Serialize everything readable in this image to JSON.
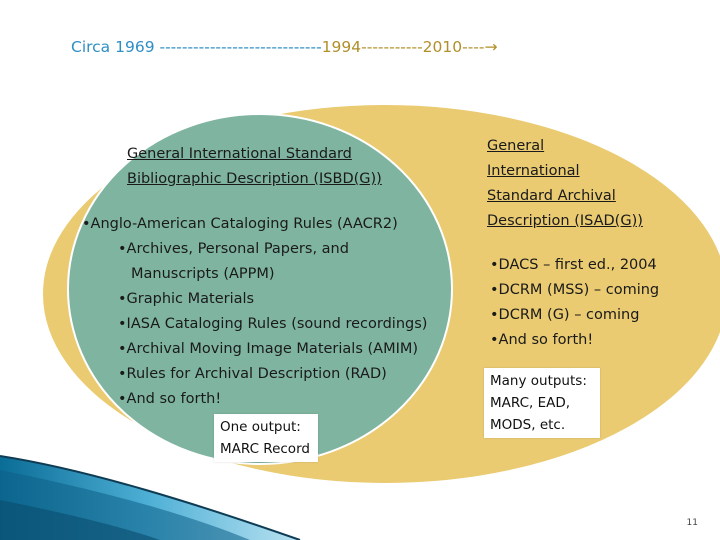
{
  "timeline": {
    "start": "Circa 1969",
    "dash1": " -----------------------------",
    "mid": "1994",
    "dash2": "-----------",
    "end": "2010",
    "dash3": "----",
    "arrow": "→"
  },
  "isbd": {
    "title_line1": "General International Standard",
    "title_line2": "Bibliographic Description (ISBD(G))",
    "items": [
      "•Anglo-American Cataloging Rules (AACR2)",
      "•Archives, Personal Papers, and",
      "Manuscripts (APPM)",
      "•Graphic Materials",
      "•IASA Cataloging Rules (sound recordings)",
      "•Archival Moving Image Materials (AMIM)",
      "•Rules for Archival Description (RAD)",
      "•And so forth!"
    ],
    "output_line1": "One output:",
    "output_line2": "MARC Record"
  },
  "isad": {
    "title_line1": "General",
    "title_line2": "International",
    "title_line3": "Standard Archival",
    "title_line4": "Description (ISAD(G))",
    "items": [
      "•DACS – first ed., 2004",
      "•DCRM (MSS) – coming",
      "•DCRM (G) – coming",
      "•And so forth!"
    ],
    "output_line1": "Many outputs:",
    "output_line2": "MARC, EAD,",
    "output_line3": "MODS, etc."
  },
  "page_number": "11",
  "colors": {
    "outer_ellipse": "#eacb72",
    "inner_ellipse": "#7fb5a0",
    "timeline_blue": "#2e8fc4",
    "timeline_gold": "#b0902a"
  }
}
